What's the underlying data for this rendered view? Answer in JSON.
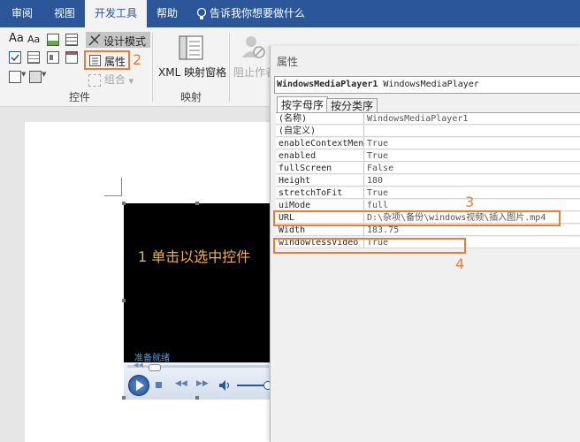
{
  "ribbon_tabs": [
    "审阅",
    "视图",
    "开发工具",
    "帮助"
  ],
  "tell_me": "告诉我你想要做什么",
  "controls": {
    "design_mode": "设计模式",
    "properties": "属性",
    "group": "组合",
    "label": "控件"
  },
  "mapping": {
    "xml_pane": "XML 映射窗格",
    "label": "映射"
  },
  "protect": {
    "block_authors": "阻止作者"
  },
  "aa_icons": [
    "Aa",
    "Aa"
  ],
  "properties_pane": {
    "title": "属性",
    "object_name": "WindowsMediaPlayer1",
    "object_type": "WindowsMediaPlayer",
    "tabs": [
      "按字母序",
      "按分类序"
    ],
    "rows": [
      {
        "name": "(名称)",
        "value": "WindowsMediaPlayer1"
      },
      {
        "name": "(自定义)",
        "value": ""
      },
      {
        "name": "enableContextMenu",
        "value": "True"
      },
      {
        "name": "enabled",
        "value": "True"
      },
      {
        "name": "fullScreen",
        "value": "False"
      },
      {
        "name": "Height",
        "value": "180"
      },
      {
        "name": "stretchToFit",
        "value": "True"
      },
      {
        "name": "uiMode",
        "value": "full"
      },
      {
        "name": "URL",
        "value": "D:\\杂项\\备份\\windows视频\\插入图片.mp4"
      },
      {
        "name": "Width",
        "value": "183.75"
      },
      {
        "name": "windowlessVideo",
        "value": "True"
      }
    ]
  },
  "video": {
    "overlay_text": "1 单击以选中控件",
    "status": "准备就绪"
  },
  "annotations": [
    "2",
    "3",
    "4"
  ],
  "colors": {
    "ribbon": "#2b579a",
    "accent": "#ed7d31",
    "overlay_text": "#f2b130",
    "status_text": "#5b9bd5"
  }
}
